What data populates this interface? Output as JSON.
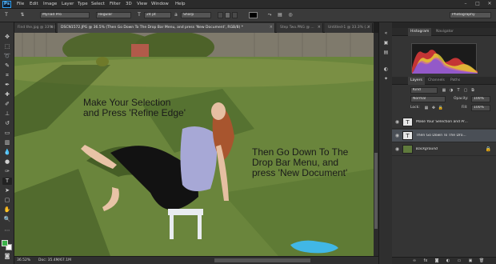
{
  "app": {
    "logo": "Ps"
  },
  "menu": [
    "File",
    "Edit",
    "Image",
    "Layer",
    "Type",
    "Select",
    "Filter",
    "3D",
    "View",
    "Window",
    "Help"
  ],
  "window_controls": [
    "–",
    "□",
    "✕"
  ],
  "options": {
    "font_family": "Myriad Pro",
    "font_style": "Regular",
    "font_size": "24 pt",
    "anti_alias": "Sharp",
    "workspace": "Photography"
  },
  "tabs": [
    {
      "label": "Find the.jpg @ 33% (",
      "active": false
    },
    {
      "label": "DSCN1572.JPG @ 36.5% (Then Go Down To The Drop Bar Menu, and press 'New Document', RGB/8) *",
      "active": true
    },
    {
      "label": "Step Two.PNG @ ...",
      "active": false
    },
    {
      "label": "Untitled-1 @ 33.3% (...",
      "active": false
    }
  ],
  "canvas_text": {
    "caption_1": "Make Your Selection\nand Press 'Refine Edge'",
    "caption_2": "Then Go Down To The\nDrop Bar Menu, and\npress 'New Document'"
  },
  "status": {
    "zoom": "36.52%",
    "doc": "Doc: 35.4M/67.1M"
  },
  "panels": {
    "top_tabs": [
      "Histogram",
      "Navigator"
    ],
    "mid_tabs": [
      "Layers",
      "Channels",
      "Paths"
    ],
    "layers_controls": {
      "kind": "Kind",
      "blend_mode": "Normal",
      "opacity_label": "Opacity:",
      "opacity": "100%",
      "lock_label": "Lock:",
      "fill_label": "Fill:",
      "fill": "100%"
    },
    "layers": [
      {
        "name": "Make Your Selection and Pr...",
        "type": "text",
        "selected": false
      },
      {
        "name": "Then Go Down To The Dro...",
        "type": "text",
        "selected": true
      },
      {
        "name": "Background",
        "type": "image",
        "selected": false
      }
    ],
    "footer_icons": [
      "link-icon",
      "fx-icon",
      "mask-icon",
      "adjustment-icon",
      "folder-icon",
      "new-layer-icon",
      "trash-icon"
    ]
  },
  "colors": {
    "foreground": "#3bb24a",
    "background": "#ffffff",
    "ps_blue": "#2fa3f7",
    "selected_layer": "#4a4f56"
  }
}
